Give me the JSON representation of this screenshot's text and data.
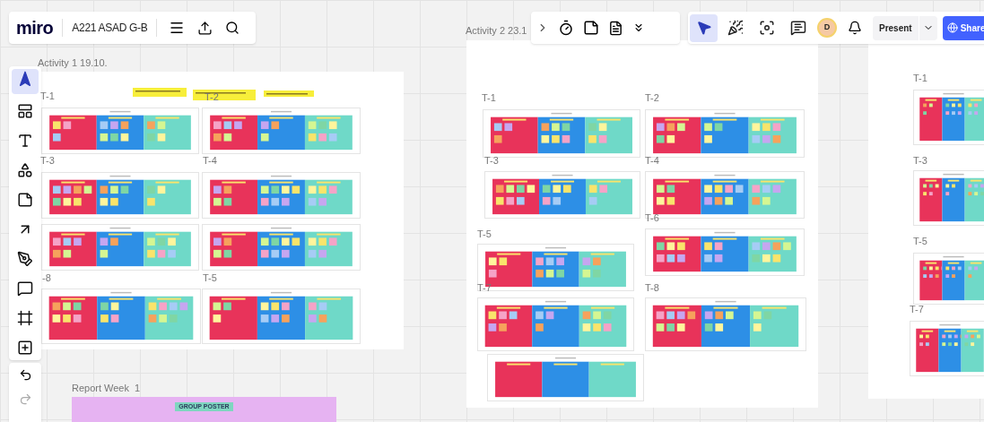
{
  "header": {
    "logo": "miro",
    "board_name": "A221 ASAD G-B"
  },
  "top_tools": [
    {
      "kind": "cursor",
      "selected": true
    },
    {
      "kind": "celebrate",
      "selected": false
    },
    {
      "kind": "focus",
      "selected": false
    },
    {
      "kind": "comments",
      "selected": false
    }
  ],
  "avatar": {
    "initial": "D"
  },
  "present": {
    "label": "Present"
  },
  "share": {
    "label": "Share"
  },
  "left_tools": [
    {
      "kind": "select",
      "selected": true
    },
    {
      "kind": "templates",
      "selected": false
    },
    {
      "kind": "text",
      "selected": false
    },
    {
      "kind": "shapes",
      "selected": false
    },
    {
      "kind": "sticky",
      "selected": false
    },
    {
      "kind": "arrow",
      "selected": false
    },
    {
      "kind": "pen",
      "selected": false
    },
    {
      "kind": "comment",
      "selected": false
    },
    {
      "kind": "frame",
      "selected": false
    },
    {
      "kind": "more",
      "selected": false
    }
  ],
  "frames": [
    {
      "title": "Activity 1 19.10.",
      "boards": [
        {
          "label": "T-1"
        },
        {
          "label": "T-2"
        },
        {
          "label": "T-3"
        },
        {
          "label": "T-4"
        },
        {
          "label": "-8"
        },
        {
          "label": "T-5"
        }
      ]
    },
    {
      "title": "Activity 2 23.1",
      "boards": [
        {
          "label": "T-1"
        },
        {
          "label": "T-2"
        },
        {
          "label": "T-3"
        },
        {
          "label": "T-4"
        },
        {
          "label": "T-6"
        },
        {
          "label": "T-5"
        },
        {
          "label": "T-7"
        },
        {
          "label": "T-8"
        }
      ]
    },
    {
      "boards": [
        {
          "label": "T-1"
        },
        {
          "label": "T-3"
        },
        {
          "label": "T-5"
        },
        {
          "label": "T-7"
        }
      ]
    }
  ],
  "report": {
    "title": "Report Week  1",
    "poster_title": "GROUP POSTER"
  }
}
